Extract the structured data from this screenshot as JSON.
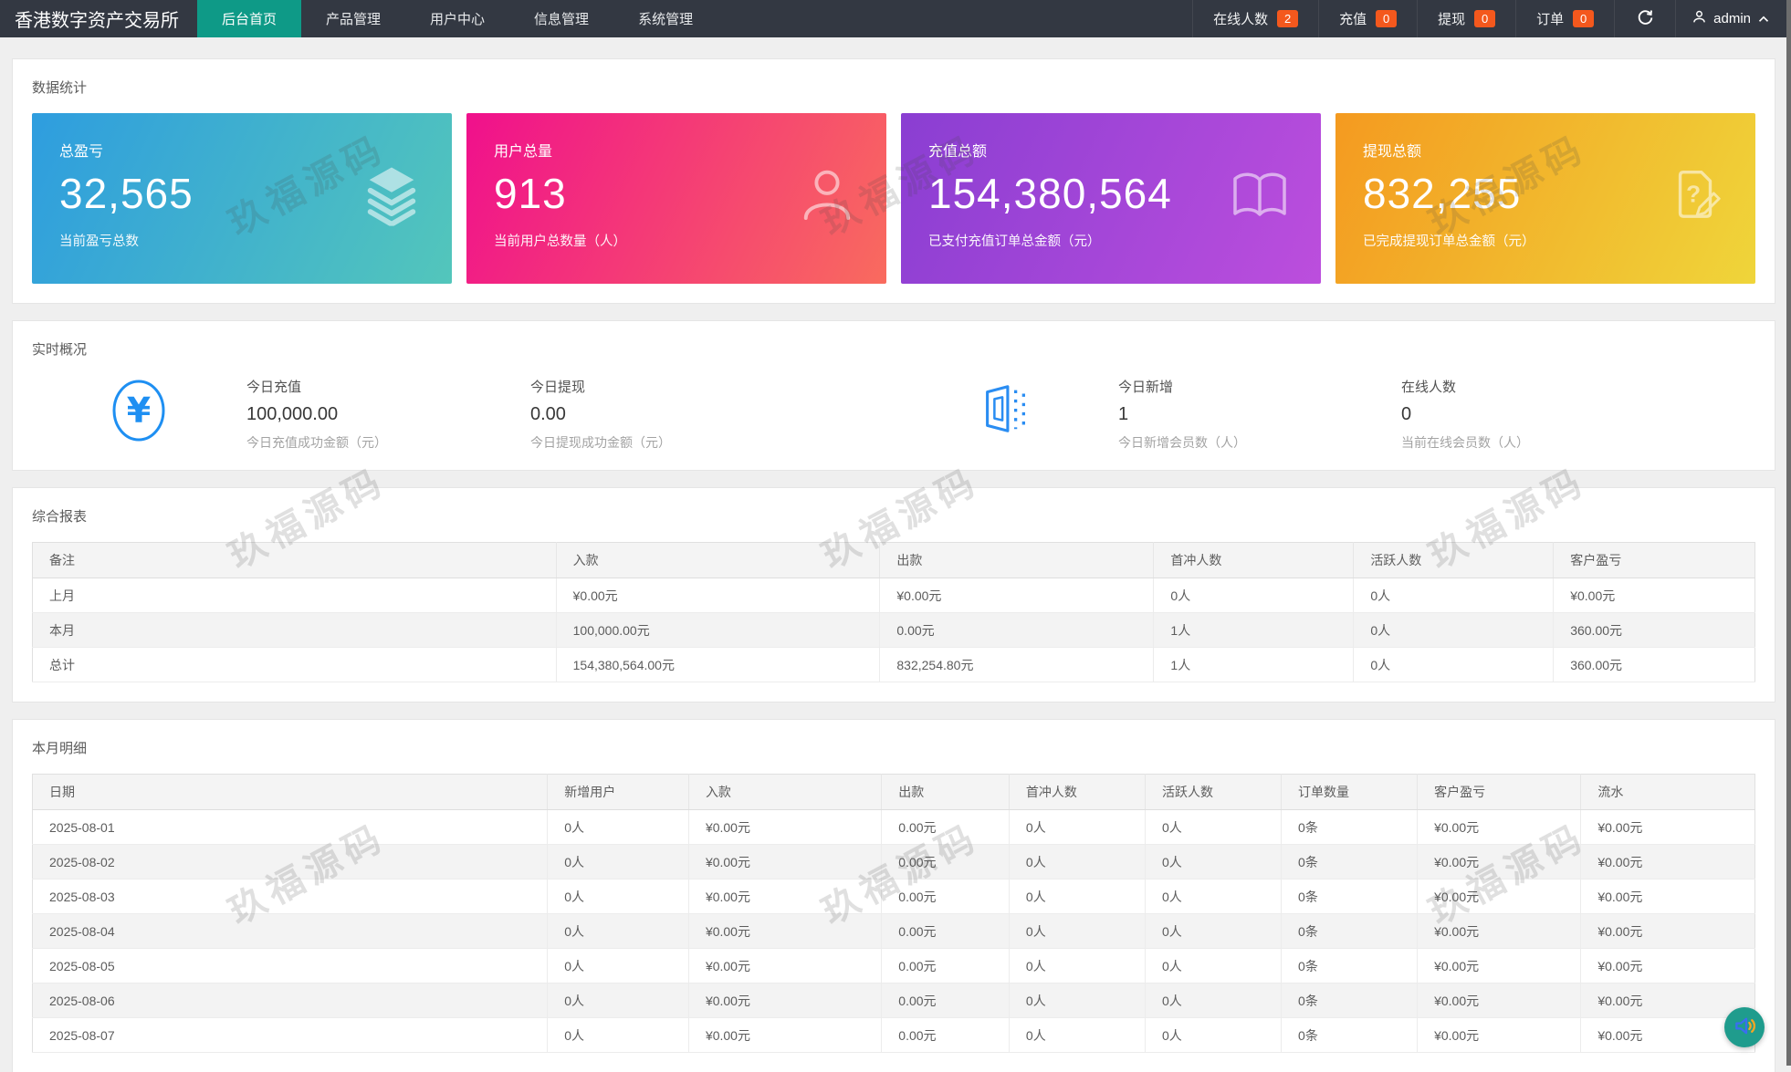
{
  "navbar": {
    "brand": "香港数字资产交易所",
    "menu": [
      {
        "label": "后台首页",
        "active": true
      },
      {
        "label": "产品管理",
        "active": false
      },
      {
        "label": "用户中心",
        "active": false
      },
      {
        "label": "信息管理",
        "active": false
      },
      {
        "label": "系统管理",
        "active": false
      }
    ],
    "status_items": [
      {
        "label": "在线人数",
        "count": "2"
      },
      {
        "label": "充值",
        "count": "0"
      },
      {
        "label": "提现",
        "count": "0"
      },
      {
        "label": "订单",
        "count": "0"
      }
    ],
    "user": {
      "name": "admin"
    }
  },
  "stats_section": {
    "title": "数据统计",
    "cards": [
      {
        "label": "总盈亏",
        "value": "32,565",
        "desc": "当前盈亏总数",
        "icon": "layers-icon",
        "gradient": [
          "#2e9ddf",
          "#53c6bb"
        ]
      },
      {
        "label": "用户总量",
        "value": "913",
        "desc": "当前用户总数量（人）",
        "icon": "user-icon",
        "gradient": [
          "#f0108c",
          "#f96b5e"
        ]
      },
      {
        "label": "充值总额",
        "value": "154,380,564",
        "desc": "已支付充值订单总金额（元）",
        "icon": "book-icon",
        "gradient": [
          "#8a3ed2",
          "#bc4edd"
        ]
      },
      {
        "label": "提现总额",
        "value": "832,255",
        "desc": "已完成提现订单总金额（元）",
        "icon": "question-doc-icon",
        "gradient": [
          "#f49a20",
          "#efd53a"
        ]
      }
    ]
  },
  "realtime_section": {
    "title": "实时概况",
    "items": [
      {
        "label": "今日充值",
        "value": "100,000.00",
        "desc": "今日充值成功金额（元）"
      },
      {
        "label": "今日提现",
        "value": "0.00",
        "desc": "今日提现成功金额（元）"
      },
      {
        "label": "今日新增",
        "value": "1",
        "desc": "今日新增会员数（人）"
      },
      {
        "label": "在线人数",
        "value": "0",
        "desc": "当前在线会员数（人）"
      }
    ]
  },
  "summary_report": {
    "title": "综合报表",
    "columns": [
      "备注",
      "入款",
      "出款",
      "首冲人数",
      "活跃人数",
      "客户盈亏"
    ],
    "rows": [
      [
        "上月",
        "¥0.00元",
        "¥0.00元",
        "0人",
        "0人",
        "¥0.00元"
      ],
      [
        "本月",
        "100,000.00元",
        "0.00元",
        "1人",
        "0人",
        "360.00元"
      ],
      [
        "总计",
        "154,380,564.00元",
        "832,254.80元",
        "1人",
        "0人",
        "360.00元"
      ]
    ]
  },
  "month_detail": {
    "title": "本月明细",
    "columns": [
      "日期",
      "新增用户",
      "入款",
      "出款",
      "首冲人数",
      "活跃人数",
      "订单数量",
      "客户盈亏",
      "流水"
    ],
    "rows": [
      [
        "2025-08-01",
        "0人",
        "¥0.00元",
        "0.00元",
        "0人",
        "0人",
        "0条",
        "¥0.00元",
        "¥0.00元"
      ],
      [
        "2025-08-02",
        "0人",
        "¥0.00元",
        "0.00元",
        "0人",
        "0人",
        "0条",
        "¥0.00元",
        "¥0.00元"
      ],
      [
        "2025-08-03",
        "0人",
        "¥0.00元",
        "0.00元",
        "0人",
        "0人",
        "0条",
        "¥0.00元",
        "¥0.00元"
      ],
      [
        "2025-08-04",
        "0人",
        "¥0.00元",
        "0.00元",
        "0人",
        "0人",
        "0条",
        "¥0.00元",
        "¥0.00元"
      ],
      [
        "2025-08-05",
        "0人",
        "¥0.00元",
        "0.00元",
        "0人",
        "0人",
        "0条",
        "¥0.00元",
        "¥0.00元"
      ],
      [
        "2025-08-06",
        "0人",
        "¥0.00元",
        "0.00元",
        "0人",
        "0人",
        "0条",
        "¥0.00元",
        "¥0.00元"
      ],
      [
        "2025-08-07",
        "0人",
        "¥0.00元",
        "0.00元",
        "0人",
        "0人",
        "0条",
        "¥0.00元",
        "¥0.00元"
      ]
    ]
  },
  "watermark": {
    "text": "玖福源码"
  },
  "floating_button": {
    "icon": "speaker-icon"
  },
  "colors": {
    "navbar_bg": "#333842",
    "active_tab": "#0e9a87",
    "badge": "#f4581d",
    "blue_icon": "#1e8ff2",
    "fab_bg": "#1f9c8d",
    "fab_speaker": "#3a6ef0",
    "fab_waves": "#f5a623"
  }
}
